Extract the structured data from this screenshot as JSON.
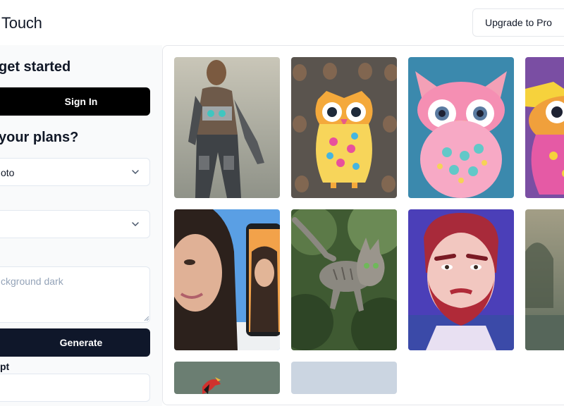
{
  "header": {
    "brand": "Touch",
    "upgrade_label": "Upgrade to Pro"
  },
  "sidebar": {
    "get_started_heading": "get started",
    "sign_in_label": "Sign In",
    "plans_heading": "your plans?",
    "select_one_value": "oto",
    "select_two_value": "",
    "prompt_placeholder": "ckground dark",
    "generate_label": "Generate",
    "pt_label": "pt"
  },
  "gallery": {
    "tiles": [
      {
        "name": "armored-woman-image",
        "icon": "robot-figure"
      },
      {
        "name": "owl-pattern-image",
        "icon": "owl"
      },
      {
        "name": "pink-owl-image",
        "icon": "owl"
      },
      {
        "name": "purple-owl-image",
        "icon": "owl"
      },
      {
        "name": "woman-phone-image",
        "icon": "portrait"
      },
      {
        "name": "jumping-cat-image",
        "icon": "cat"
      },
      {
        "name": "bearded-man-image",
        "icon": "portrait"
      },
      {
        "name": "misty-landscape-image",
        "icon": "landscape"
      },
      {
        "name": "red-bird-image",
        "icon": "bird"
      },
      {
        "name": "placeholder-image",
        "icon": "blank"
      }
    ]
  }
}
